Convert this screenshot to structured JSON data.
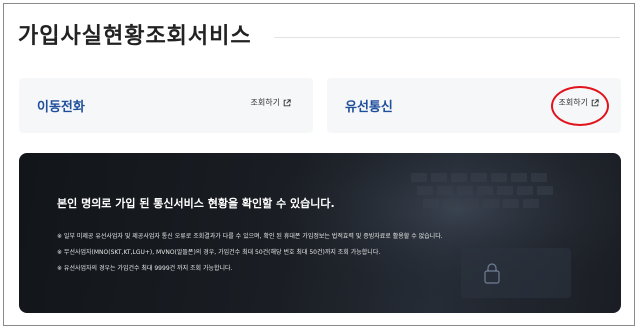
{
  "page": {
    "title": "가입사실현황조회서비스"
  },
  "cards": [
    {
      "label": "이동전화",
      "link_label": "조회하기"
    },
    {
      "label": "유선통신",
      "link_label": "조회하기"
    }
  ],
  "banner": {
    "heading": "본인 명의로 가입 된 통신서비스 현황을 확인할 수 있습니다.",
    "notices": [
      "※ 일부 미제공 유선사업자 및 제공사업자 통신 오류로 조회결과가 다를 수 있으며, 확인 된 휴대폰 가입정보는 법적효력 및 증빙자료로 활용할 수 없습니다.",
      "※ 무선사업자(MNO(SKT,KT,LGU+), MVNO(알뜰폰)의 경우, 가입건수 최대 50건(해당 번호 최대 50건)까지 조회 가능합니다.",
      "※ 유선사업자의 경우는 가입건수 최대 9999건 까지 조회 가능합니다."
    ]
  },
  "colors": {
    "card_label": "#1f4e9c",
    "highlight": "#e1131d",
    "banner_bg": "#1a1e24"
  },
  "icons": {
    "external_link": "external-link-icon"
  }
}
